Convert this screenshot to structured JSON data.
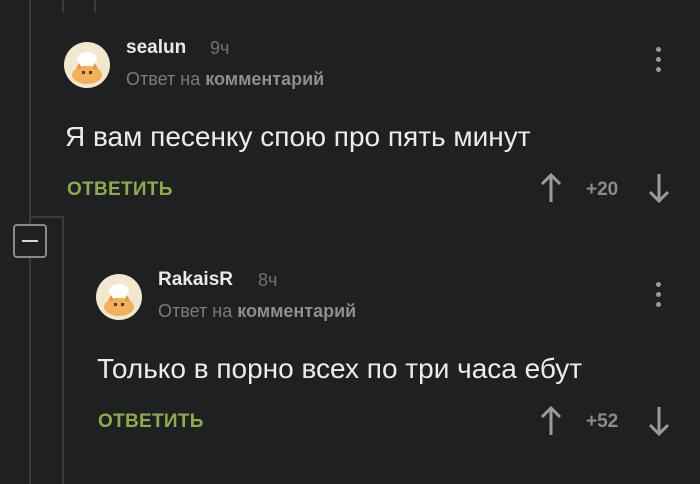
{
  "comments": [
    {
      "author": "sealun",
      "time": "9ч",
      "reply_prefix": "Ответ на ",
      "reply_target": "комментарий",
      "text": "Я вам песенку спою про пять минут",
      "reply_label": "ОТВЕТИТЬ",
      "rating": "+20"
    },
    {
      "author": "RakaisR",
      "time": "8ч",
      "reply_prefix": "Ответ на ",
      "reply_target": "комментарий",
      "text": "Только в порно всех по три часа ебут",
      "reply_label": "ОТВЕТИТЬ",
      "rating": "+52"
    }
  ],
  "icons": {
    "upvote": "arrow-up-icon",
    "downvote": "arrow-down-icon",
    "menu": "kebab-menu-icon",
    "collapse": "minus-icon"
  },
  "colors": {
    "background": "#1f2022",
    "accent_reply": "#8dab4b"
  }
}
